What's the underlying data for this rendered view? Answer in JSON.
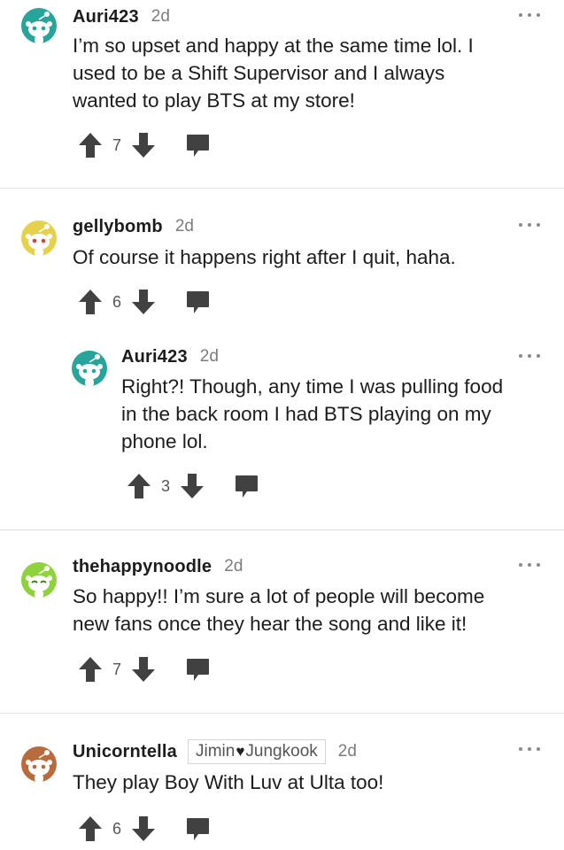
{
  "colors": {
    "accent_teal": "#27a59a",
    "accent_yellow": "#e6d14a",
    "accent_green": "#8fd23e",
    "accent_brown": "#b86b3d",
    "icon_dark": "#414141",
    "divider": "#e3e3e3"
  },
  "comments": [
    {
      "username": "Auri423",
      "age": "2d",
      "avatar_icon": "snoo-avatar-teal",
      "lines": [
        "I’m so upset and happy at the same time lol. I",
        "used to be a Shift Supervisor and I always",
        "wanted to play BTS at my store!"
      ],
      "score": "7"
    },
    {
      "username": "gellybomb",
      "age": "2d",
      "avatar_icon": "snoo-avatar-yellow",
      "lines": [
        "Of course it happens right after I quit, haha."
      ],
      "score": "6"
    },
    {
      "username": "Auri423",
      "age": "2d",
      "avatar_icon": "snoo-avatar-teal",
      "lines": [
        "Right?! Though, any time I was pulling food",
        "in the back room I had BTS playing on my",
        "phone lol."
      ],
      "score": "3"
    },
    {
      "username": "thehappynoodle",
      "age": "2d",
      "avatar_icon": "snoo-avatar-green",
      "lines": [
        "So happy!! I’m sure a lot of people will become",
        "new fans once they hear the song and like it!"
      ],
      "score": "7"
    },
    {
      "username": "Unicorntella",
      "age": "2d",
      "avatar_icon": "snoo-avatar-brown",
      "flair": {
        "left": "Jimin",
        "right": "Jungkook",
        "heart": "♥"
      },
      "lines": [
        "They play Boy With Luv at Ulta too!"
      ],
      "score": "6"
    }
  ]
}
